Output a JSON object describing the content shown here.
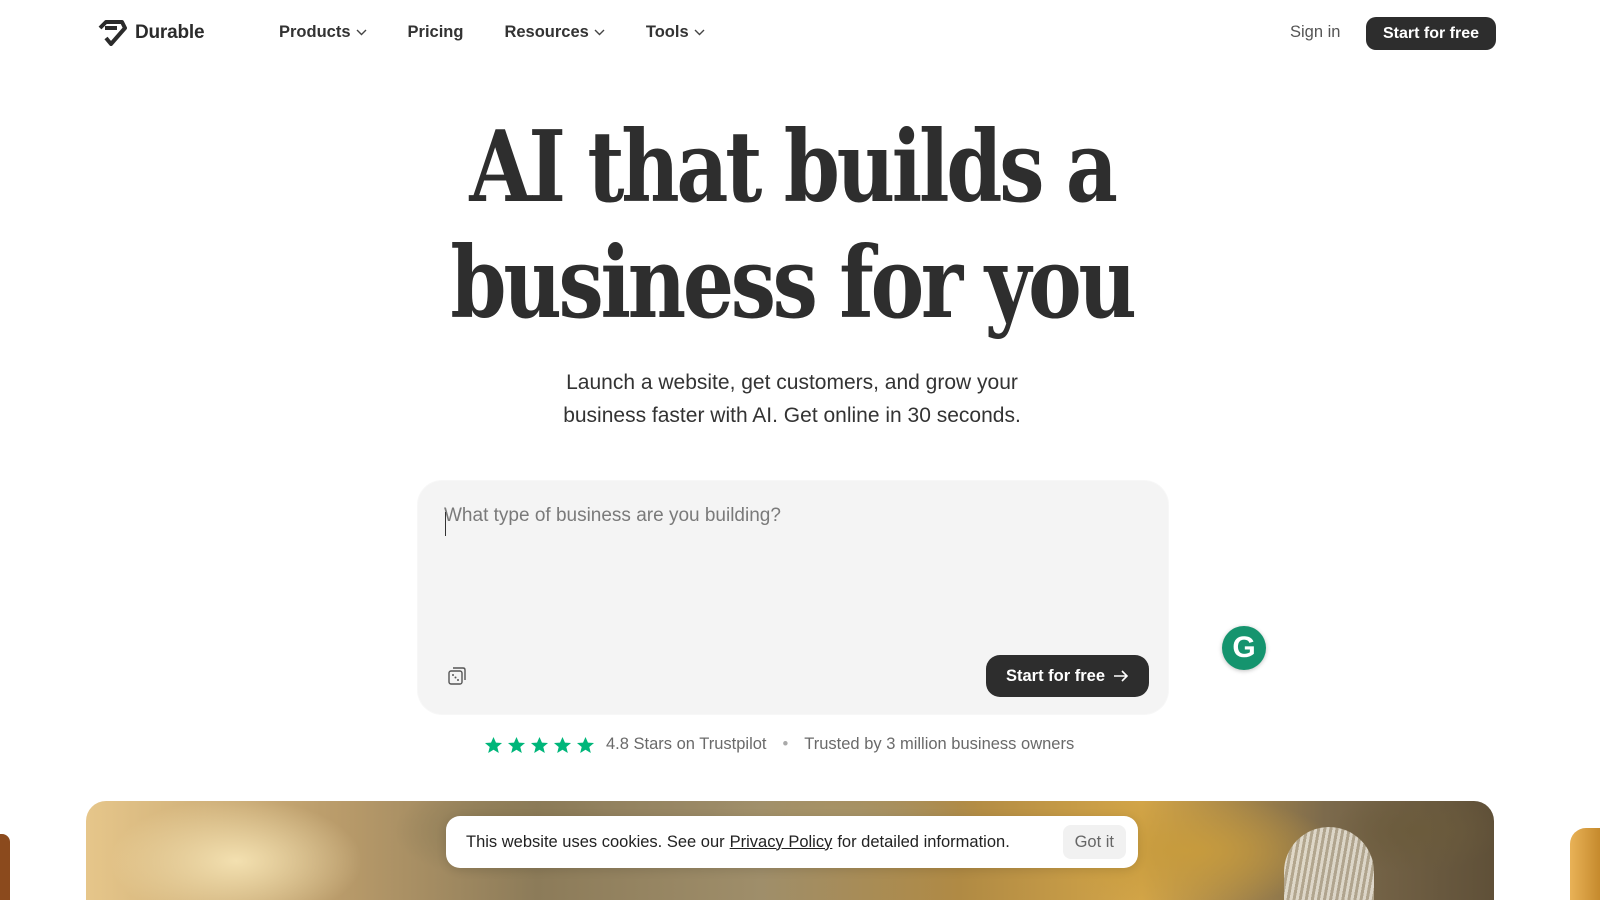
{
  "nav": {
    "brand": "Durable",
    "links": [
      {
        "label": "Products",
        "has_dropdown": true
      },
      {
        "label": "Pricing",
        "has_dropdown": false
      },
      {
        "label": "Resources",
        "has_dropdown": true
      },
      {
        "label": "Tools",
        "has_dropdown": true
      }
    ],
    "sign_in": "Sign in",
    "cta": "Start for free"
  },
  "hero": {
    "title_line1": "AI that builds a",
    "title_line2": "business for you",
    "subtitle_line1": "Launch a website, get customers, and grow your",
    "subtitle_line2": "business faster with AI. Get online in 30 seconds."
  },
  "prompt": {
    "placeholder": "What type of business are you building?",
    "value": "",
    "cta": "Start for free",
    "shuffle_icon": "shuffle-dice-icon",
    "cta_icon": "arrow-right-icon"
  },
  "trust": {
    "stars": 5,
    "rating_text": "4.8 Stars on Trustpilot",
    "separator": "•",
    "trusted_text": "Trusted by 3 million business owners"
  },
  "cookie": {
    "text_before": "This website uses cookies. See our",
    "link": "Privacy Policy",
    "text_after": "for detailed information.",
    "button": "Got it"
  },
  "extension": {
    "icon": "grammarly-icon",
    "glyph": "G"
  },
  "colors": {
    "primary_dark": "#2d2d2d",
    "card_bg": "#f4f4f4",
    "star_green": "#00b67a",
    "grammarly_green": "#15946e"
  }
}
